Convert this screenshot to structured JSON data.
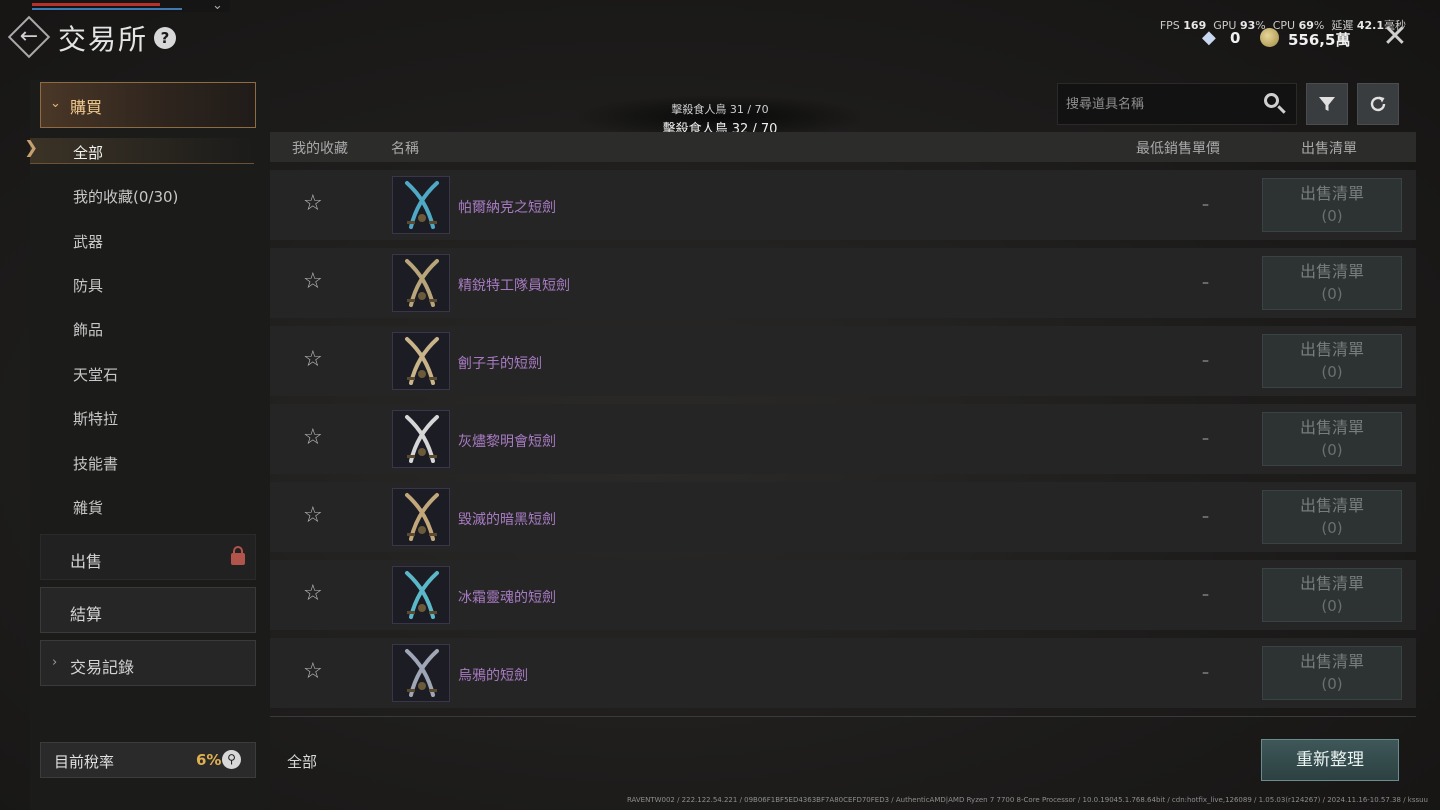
{
  "header": {
    "title": "交易所",
    "back_glyph": "←",
    "help_glyph": "?",
    "close_glyph": "✕"
  },
  "hud": {
    "fps_label": "FPS",
    "fps_value": "169",
    "gpu_label": "GPU",
    "gpu_value": "93",
    "cpu_label": "CPU",
    "cpu_value": "69",
    "percent_unit": "%",
    "latency_label": "延遲",
    "latency_value": "42.1",
    "latency_unit": "毫秒",
    "diamond_count": "0",
    "gold_count": "556,5萬",
    "diamond_icon": "diamond-icon",
    "coin_icon": "gold-coin-icon"
  },
  "quest": {
    "line1": "擊殺食人鳥 31 / 70",
    "line2": "擊殺食人鳥 32 / 70"
  },
  "sidebar": {
    "buy_label": "購買",
    "sub_items": [
      {
        "label": "全部",
        "active": true
      },
      {
        "label": "我的收藏(0/30)"
      },
      {
        "label": "武器"
      },
      {
        "label": "防具"
      },
      {
        "label": "飾品"
      },
      {
        "label": "天堂石"
      },
      {
        "label": "斯特拉"
      },
      {
        "label": "技能書"
      },
      {
        "label": "雜貨"
      }
    ],
    "sell_label": "出售",
    "settle_label": "結算",
    "record_label": "交易記錄"
  },
  "tax": {
    "label": "目前稅率",
    "value": "6%"
  },
  "search": {
    "placeholder": "搜尋道具名稱"
  },
  "table": {
    "col_favorite": "我的收藏",
    "col_name": "名稱",
    "col_min_price": "最低銷售單價",
    "col_listing": "出售清單",
    "rows": [
      {
        "name": "帕爾納克之短劍",
        "price": "–",
        "sell_label": "出售清單",
        "sell_count": "(0)",
        "blade_color": "#4fa9c4"
      },
      {
        "name": "精銳特工隊員短劍",
        "price": "–",
        "sell_label": "出售清單",
        "sell_count": "(0)",
        "blade_color": "#b9a57a"
      },
      {
        "name": "劊子手的短劍",
        "price": "–",
        "sell_label": "出售清單",
        "sell_count": "(0)",
        "blade_color": "#c9b48a"
      },
      {
        "name": "灰燼黎明會短劍",
        "price": "–",
        "sell_label": "出售清單",
        "sell_count": "(0)",
        "blade_color": "#d6d6d6"
      },
      {
        "name": "毀滅的暗黑短劍",
        "price": "–",
        "sell_label": "出售清單",
        "sell_count": "(0)",
        "blade_color": "#c2a77a"
      },
      {
        "name": "冰霜靈魂的短劍",
        "price": "–",
        "sell_label": "出售清單",
        "sell_count": "(0)",
        "blade_color": "#5bb8c9"
      },
      {
        "name": "烏鴉的短劍",
        "price": "–",
        "sell_label": "出售清單",
        "sell_count": "(0)",
        "blade_color": "#9fa6b5"
      }
    ]
  },
  "footer": {
    "filter_label": "全部",
    "refresh_label": "重新整理",
    "sysinfo": "RAVENTW002 / 222.122.54.221 / 09B06F1BF5ED4363BF7A80CEFD70FED3 / AuthenticAMD|AMD Ryzen 7 7700 8-Core Processor / 10.0.19045.1.768.64bit / cdn:hotfix_live,126089 / 1.05.03(r124267) / 2024.11.16-10.57.38 / kssuu"
  },
  "colors": {
    "accent_gold": "#f0c98d",
    "item_name_purple": "#a77ac2",
    "tax_value": "#e0b050",
    "refresh_teal": "#3e5758"
  }
}
